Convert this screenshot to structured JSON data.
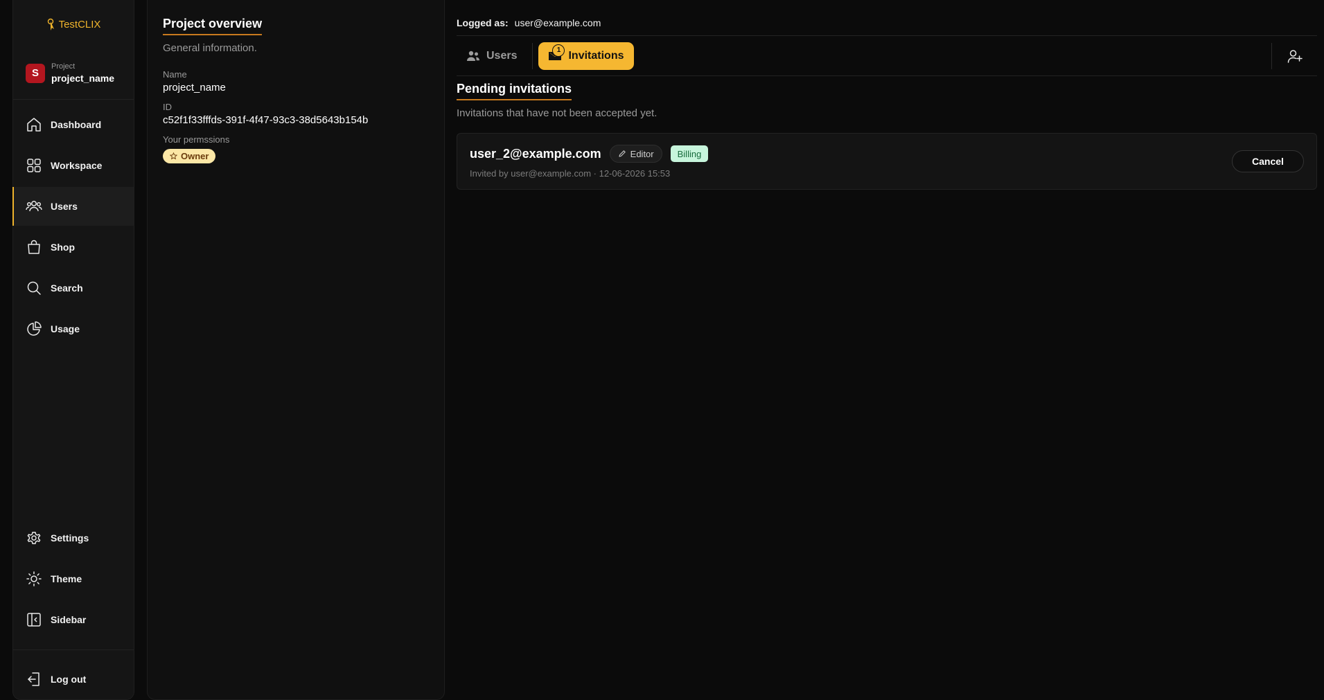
{
  "app": {
    "logo_text": "TestCLIX"
  },
  "project": {
    "label": "Project",
    "name": "project_name",
    "avatar_letter": "S"
  },
  "sidebar": {
    "items": [
      {
        "label": "Dashboard",
        "icon": "home-icon"
      },
      {
        "label": "Workspace",
        "icon": "grid-icon"
      },
      {
        "label": "Users",
        "icon": "users-icon",
        "active": true
      },
      {
        "label": "Shop",
        "icon": "shopping-bag-icon"
      },
      {
        "label": "Search",
        "icon": "search-icon"
      },
      {
        "label": "Usage",
        "icon": "pie-chart-icon"
      }
    ],
    "bottom_items": [
      {
        "label": "Settings",
        "icon": "gear-icon"
      },
      {
        "label": "Theme",
        "icon": "sun-icon"
      },
      {
        "label": "Sidebar",
        "icon": "sidebar-toggle-icon"
      }
    ],
    "logout": {
      "label": "Log out",
      "icon": "logout-icon"
    }
  },
  "overview": {
    "title": "Project overview",
    "subtitle": "General information.",
    "name_label": "Name",
    "name_value": "project_name",
    "id_label": "ID",
    "id_value": "c52f1f33fffds-391f-4f47-93c3-38d5643b154b",
    "permissions_label": "Your permssions",
    "permission_badge": "Owner"
  },
  "header": {
    "logged_label": "Logged as:",
    "logged_user": "user@example.com"
  },
  "tabs": {
    "users_label": "Users",
    "invitations_label": "Invitations",
    "invitations_count": "1"
  },
  "pending": {
    "title": "Pending invitations",
    "subtitle": "Invitations that have not been accepted yet.",
    "invites": [
      {
        "email": "user_2@example.com",
        "role": "Editor",
        "tag": "Billing",
        "meta": "Invited by user@example.com · 12-06-2026 15:53",
        "cancel_label": "Cancel"
      }
    ]
  },
  "colors": {
    "accent": "#f5b731",
    "background": "#0b0b0b",
    "avatar": "#b3161f",
    "billing_bg": "#c7f5dc",
    "owner_bg": "#fbe7a6"
  }
}
